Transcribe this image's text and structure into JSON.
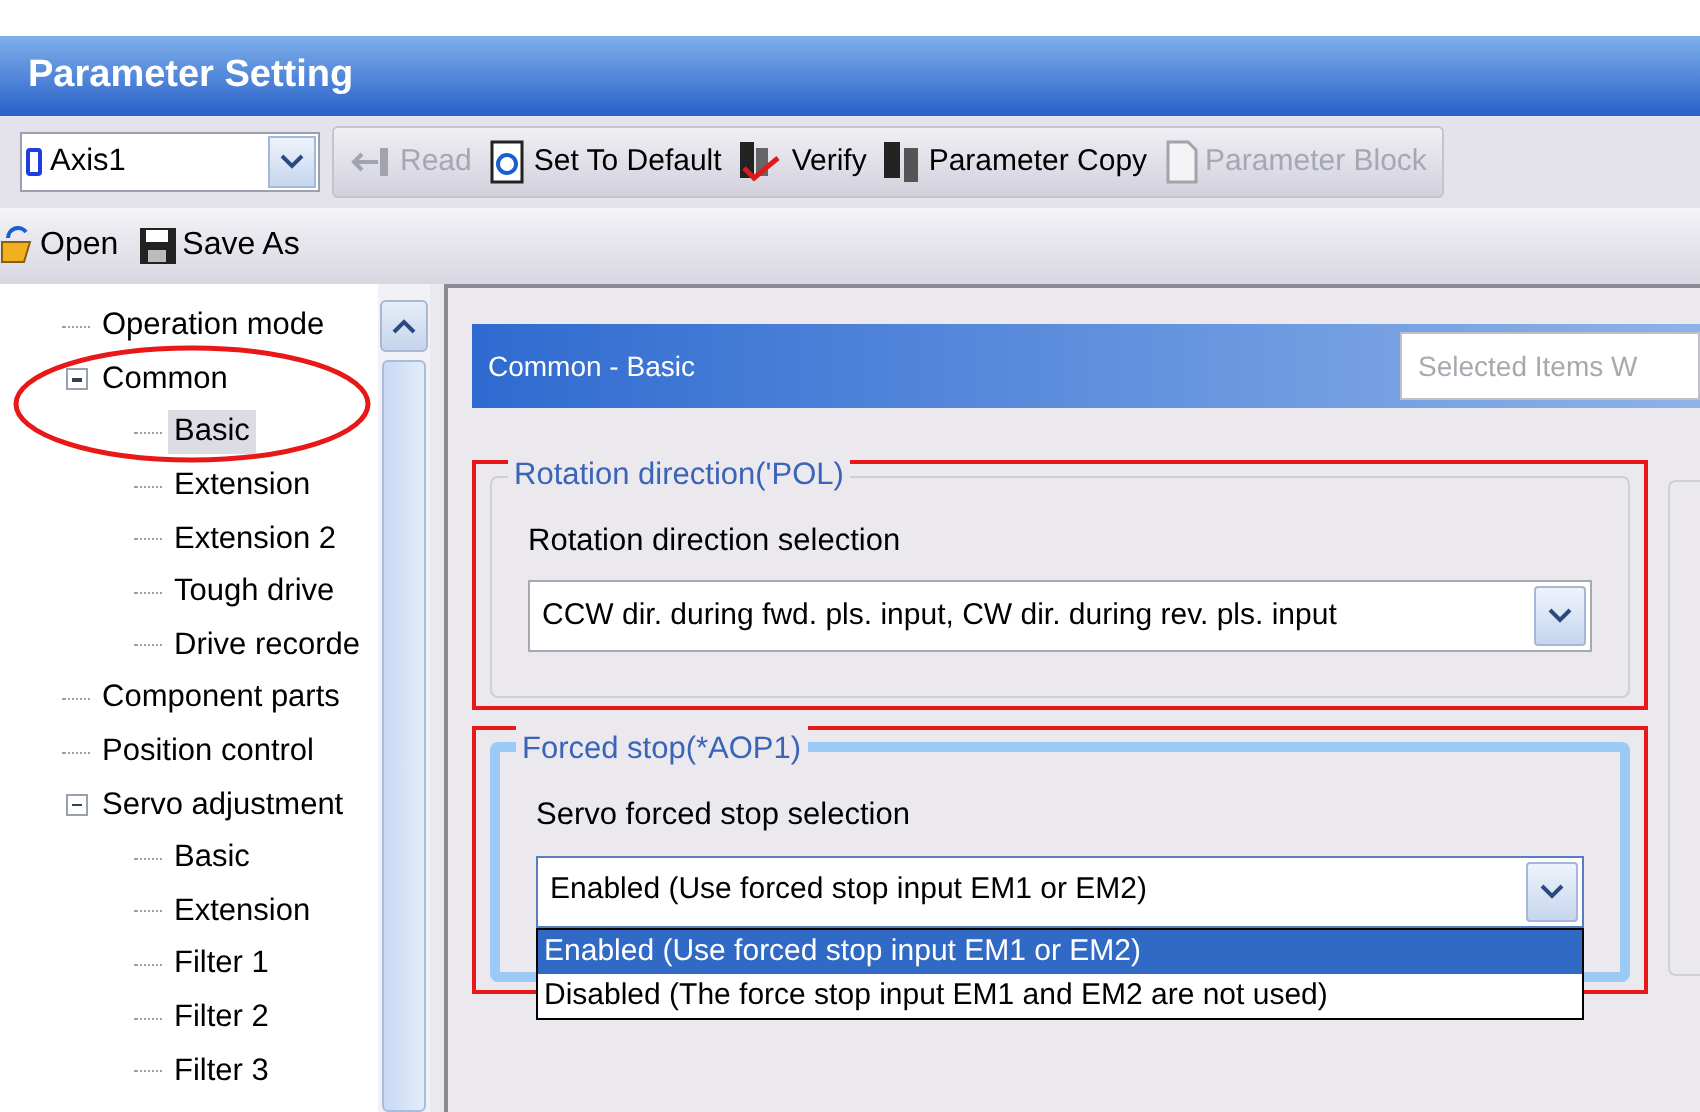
{
  "window": {
    "title": "Parameter Setting"
  },
  "axis_select": {
    "value": "Axis1"
  },
  "toolbar": [
    {
      "label": "Read",
      "kind": "read",
      "disabled": true
    },
    {
      "label": "Set To Default",
      "kind": "default",
      "disabled": false
    },
    {
      "label": "Verify",
      "kind": "verify",
      "disabled": false
    },
    {
      "label": "Parameter Copy",
      "kind": "copy",
      "disabled": false
    },
    {
      "label": "Parameter Block",
      "kind": "block",
      "disabled": true
    }
  ],
  "file_toolbar": [
    {
      "label": "Open",
      "kind": "open"
    },
    {
      "label": "Save As",
      "kind": "save"
    }
  ],
  "tree": [
    {
      "label": "Operation mode",
      "selected": false
    },
    {
      "label": "Common",
      "selected": false,
      "expanded": true,
      "children": [
        {
          "label": "Basic",
          "selected": true
        },
        {
          "label": "Extension",
          "selected": false
        },
        {
          "label": "Extension 2",
          "selected": false
        },
        {
          "label": "Tough drive",
          "selected": false
        },
        {
          "label": "Drive recorde",
          "selected": false
        }
      ]
    },
    {
      "label": "Component parts",
      "selected": false
    },
    {
      "label": "Position control",
      "selected": false
    },
    {
      "label": "Servo adjustment",
      "selected": false,
      "expanded": true,
      "children": [
        {
          "label": "Basic",
          "selected": false
        },
        {
          "label": "Extension",
          "selected": false
        },
        {
          "label": "Filter 1",
          "selected": false
        },
        {
          "label": "Filter 2",
          "selected": false
        },
        {
          "label": "Filter 3",
          "selected": false
        }
      ]
    }
  ],
  "content": {
    "title": "Common - Basic",
    "search": {
      "placeholder": "Selected Items W"
    },
    "groups": [
      {
        "legend": "Rotation direction('POL)",
        "field_label": "Rotation direction selection",
        "value": "CCW dir. during fwd. pls. input, CW dir. during rev. pls. input",
        "focused": false
      },
      {
        "legend": "Forced stop(*AOP1)",
        "field_label": "Servo forced stop selection",
        "value": "Enabled (Use forced stop input EM1 or EM2)",
        "focused": true,
        "options": [
          {
            "label": "Enabled (Use forced stop input EM1 or EM2)",
            "selected": true
          },
          {
            "label": "Disabled (The force stop input EM1 and EM2 are not used)",
            "selected": false
          }
        ]
      }
    ]
  }
}
